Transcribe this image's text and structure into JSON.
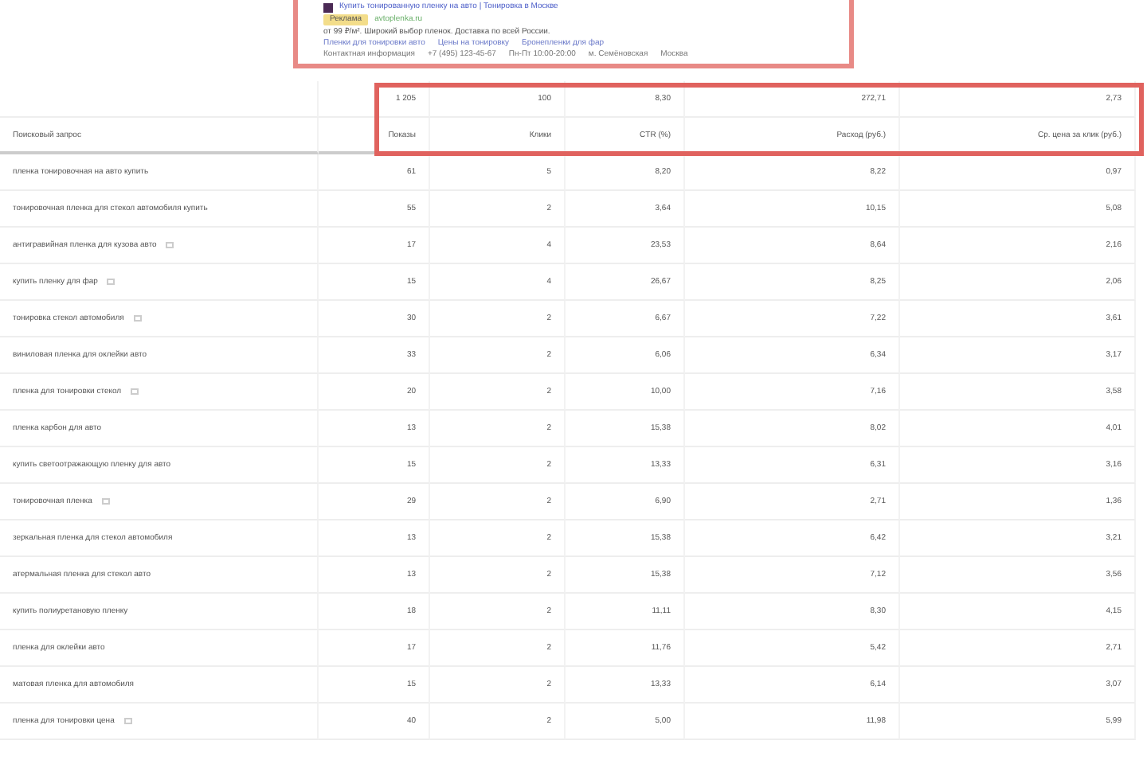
{
  "ad_preview": {
    "title": "Купить тонированную пленку на авто | Тонировка в Москве",
    "badge": "Реклама",
    "url": "avtoplenka.ru",
    "description": "от 99 ₽/м². Широкий выбор пленок. Доставка по всей России.",
    "sitelinks": [
      "Пленки для тонировки авто",
      "Цены на тонировку",
      "Бронепленки для фар"
    ],
    "contacts": [
      "Контактная информация",
      "+7 (495) 123-45-67",
      "Пн-Пт 10:00-20:00",
      "м. Семёновская",
      "Москва"
    ]
  },
  "table": {
    "totals": [
      "1 205",
      "100",
      "8,30",
      "272,71",
      "2,73"
    ],
    "columns": [
      "Поисковый запрос",
      "Показы",
      "Клики",
      "CTR (%)",
      "Расход (руб.)",
      "Ср. цена за клик (руб.)"
    ],
    "rows": [
      {
        "added": false,
        "cells": [
          "пленка тонировочная на авто купить",
          "61",
          "5",
          "8,20",
          "8,22",
          "0,97"
        ]
      },
      {
        "added": false,
        "cells": [
          "тонировочная пленка для стекол автомобиля купить",
          "55",
          "2",
          "3,64",
          "10,15",
          "5,08"
        ]
      },
      {
        "added": true,
        "cells": [
          "антигравийная пленка для кузова авто",
          "17",
          "4",
          "23,53",
          "8,64",
          "2,16"
        ]
      },
      {
        "added": true,
        "cells": [
          "купить пленку для фар",
          "15",
          "4",
          "26,67",
          "8,25",
          "2,06"
        ]
      },
      {
        "added": true,
        "cells": [
          "тонировка стекол автомобиля",
          "30",
          "2",
          "6,67",
          "7,22",
          "3,61"
        ]
      },
      {
        "added": false,
        "cells": [
          "виниловая пленка для оклейки авто",
          "33",
          "2",
          "6,06",
          "6,34",
          "3,17"
        ]
      },
      {
        "added": true,
        "cells": [
          "пленка для тонировки стекол",
          "20",
          "2",
          "10,00",
          "7,16",
          "3,58"
        ]
      },
      {
        "added": false,
        "cells": [
          "пленка карбон для авто",
          "13",
          "2",
          "15,38",
          "8,02",
          "4,01"
        ]
      },
      {
        "added": false,
        "cells": [
          "купить светоотражающую пленку для авто",
          "15",
          "2",
          "13,33",
          "6,31",
          "3,16"
        ]
      },
      {
        "added": true,
        "cells": [
          "тонировочная пленка",
          "29",
          "2",
          "6,90",
          "2,71",
          "1,36"
        ]
      },
      {
        "added": false,
        "cells": [
          "зеркальная пленка для стекол автомобиля",
          "13",
          "2",
          "15,38",
          "6,42",
          "3,21"
        ]
      },
      {
        "added": false,
        "cells": [
          "атермальная пленка для стекол авто",
          "13",
          "2",
          "15,38",
          "7,12",
          "3,56"
        ]
      },
      {
        "added": false,
        "cells": [
          "купить полиуретановую пленку",
          "18",
          "2",
          "11,11",
          "8,30",
          "4,15"
        ]
      },
      {
        "added": false,
        "cells": [
          "пленка для оклейки авто",
          "17",
          "2",
          "11,76",
          "5,42",
          "2,71"
        ]
      },
      {
        "added": false,
        "cells": [
          "матовая пленка для автомобиля",
          "15",
          "2",
          "13,33",
          "6,14",
          "3,07"
        ]
      },
      {
        "added": true,
        "cells": [
          "пленка для тонировки цена",
          "40",
          "2",
          "5,00",
          "11,98",
          "5,99"
        ]
      }
    ]
  }
}
